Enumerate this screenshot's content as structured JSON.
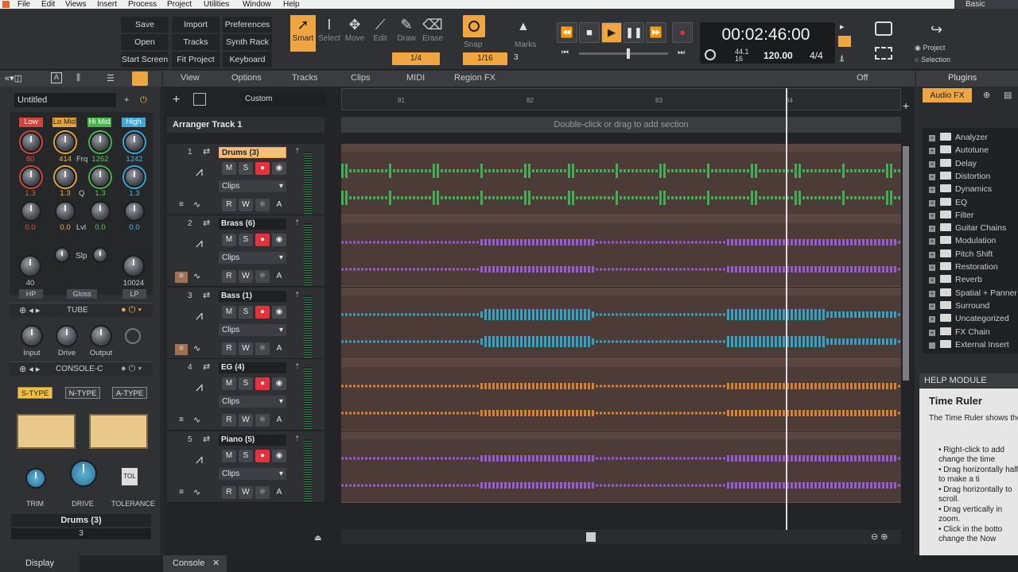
{
  "menubar": {
    "items": [
      "File",
      "Edit",
      "Views",
      "Insert",
      "Process",
      "Project",
      "Utilities",
      "Window",
      "Help"
    ],
    "workspace": "Basic"
  },
  "controlbar": {
    "buttons": [
      [
        "Save",
        "Import",
        "Preferences"
      ],
      [
        "Open",
        "Tracks",
        "Synth Rack"
      ],
      [
        "Start Screen",
        "Fit Project",
        "Keyboard"
      ]
    ],
    "tools": [
      "Smart",
      "Select",
      "Move",
      "Edit",
      "Draw",
      "Erase"
    ],
    "snap_label": "Snap",
    "snap_value": "1/4",
    "snap_grid": "1/16",
    "snap_num": "3",
    "marks_label": "Marks",
    "time": "00:02:46:00",
    "sample_rate": "44.1",
    "bit_depth": "16",
    "tempo": "120.00",
    "meter": "4/4",
    "project_opt": "Project",
    "selection_opt": "Selection"
  },
  "left": {
    "preset": "Untitled",
    "bands": [
      "Low",
      "Lo Mid",
      "Hi Mid",
      "High"
    ],
    "freq": [
      "80",
      "414",
      "1262",
      "1242"
    ],
    "freq_label": "Frq",
    "q": [
      "1.3",
      "1.3",
      "1.3",
      "1.3"
    ],
    "q_label": "Q",
    "lvl": [
      "0.0",
      "0.0",
      "0.0",
      "0.0"
    ],
    "lvl_label": "Lvl",
    "hp": "40",
    "lp": "10024",
    "slp": "Slp",
    "gloss": "Gloss",
    "hp_label": "HP",
    "lp_label": "LP",
    "tube": "TUBE",
    "tube_knobs": [
      "Input",
      "Drive",
      "Output"
    ],
    "console": "CONSOLE-C",
    "types": [
      "S-TYPE",
      "N-TYPE",
      "A-TYPE"
    ],
    "console_knobs": [
      "TRIM",
      "DRIVE",
      "TOLERANCE"
    ],
    "tol": "TOL",
    "track_name": "Drums (3)",
    "track_num": "3",
    "display": "Display"
  },
  "trackview": {
    "header": [
      "View",
      "Options",
      "Tracks",
      "Clips",
      "MIDI",
      "Region FX"
    ],
    "off": "Off",
    "custom": "Custom",
    "arranger": "Arranger Track 1",
    "section_hint": "Double-click or drag to add section",
    "ruler": [
      "81",
      "82",
      "83",
      "84"
    ],
    "tracks": [
      {
        "num": "1",
        "name": "Drums (3)",
        "color": "#3fae55",
        "sel": true,
        "clips": "Clips"
      },
      {
        "num": "2",
        "name": "Brass (6)",
        "color": "#9a59d6",
        "sel": false,
        "clips": "Clips"
      },
      {
        "num": "3",
        "name": "Bass (1)",
        "color": "#2fa3c8",
        "sel": false,
        "clips": "Clips"
      },
      {
        "num": "4",
        "name": "EG (4)",
        "color": "#d9822b",
        "sel": false,
        "clips": "Clips"
      },
      {
        "num": "5",
        "name": "Piano (5)",
        "color": "#9a59d6",
        "sel": false,
        "clips": "Clips"
      }
    ],
    "btn": {
      "m": "M",
      "s": "S",
      "r": "R",
      "w": "W",
      "a": "A"
    }
  },
  "plugins": {
    "tab": "Plugins",
    "audio_fx": "Audio FX",
    "items": [
      "Analyzer",
      "Autotune",
      "Delay",
      "Distortion",
      "Dynamics",
      "EQ",
      "Filter",
      "Guitar Chains",
      "Modulation",
      "Pitch Shift",
      "Restoration",
      "Reverb",
      "Spatial + Panner",
      "Surround",
      "Uncategorized",
      "FX Chain",
      "External Insert"
    ]
  },
  "help": {
    "title": "HELP MODULE",
    "heading": "Time Ruler",
    "intro": "The Time Ruler shows the timeline.",
    "bullets": [
      "Right-click to add change the time",
      "Drag horizontally half to make a ti",
      "Drag horizontally to scroll.",
      "Drag vertically in zoom.",
      "Click in the botto change the Now"
    ]
  },
  "bottom": {
    "console": "Console"
  }
}
